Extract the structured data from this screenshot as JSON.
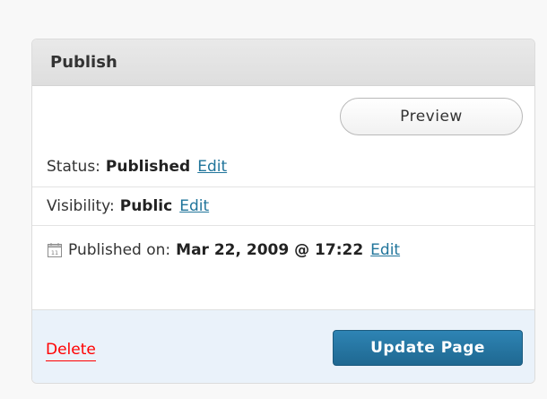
{
  "publish_box": {
    "title": "Publish",
    "preview_label": "Preview",
    "status": {
      "label": "Status:",
      "value": "Published",
      "edit": "Edit"
    },
    "visibility": {
      "label": "Visibility:",
      "value": "Public",
      "edit": "Edit"
    },
    "published_on": {
      "icon": "calendar-icon",
      "label": "Published on:",
      "value": "Mar 22, 2009 @ 17:22",
      "edit": "Edit"
    },
    "delete_label": "Delete",
    "update_label": "Update Page"
  },
  "colors": {
    "link": "#21759b",
    "delete": "#ff0000",
    "primary_button": "#21759b",
    "footer_bg": "#eaf2fa",
    "header_bg": "#e3e3e3"
  }
}
